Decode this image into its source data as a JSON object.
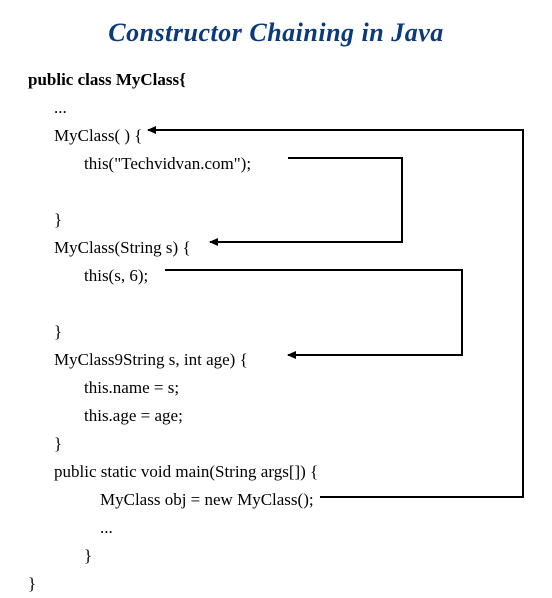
{
  "title": "Constructor Chaining in Java",
  "code": {
    "class_decl": "public class MyClass{",
    "ellipsis1": "...",
    "ctor0_sig": "MyClass( ) {",
    "ctor0_body": "this(\"Techvidvan.com\");",
    "close0": "}",
    "ctor1_sig": "MyClass(String s) {",
    "ctor1_body": "this(s, 6);",
    "close1": "}",
    "ctor2_sig": "MyClass9String s, int age) {",
    "ctor2_body1": "this.name = s;",
    "ctor2_body2": "this.age = age;",
    "close2": "}",
    "main_sig": "public static void main(String args[]) {",
    "main_body": "MyClass obj = new MyClass();",
    "ellipsis2": "...",
    "close_main": "}",
    "close_class": "}"
  },
  "arrows": {
    "stroke": "#000000",
    "stroke_width": 2
  }
}
